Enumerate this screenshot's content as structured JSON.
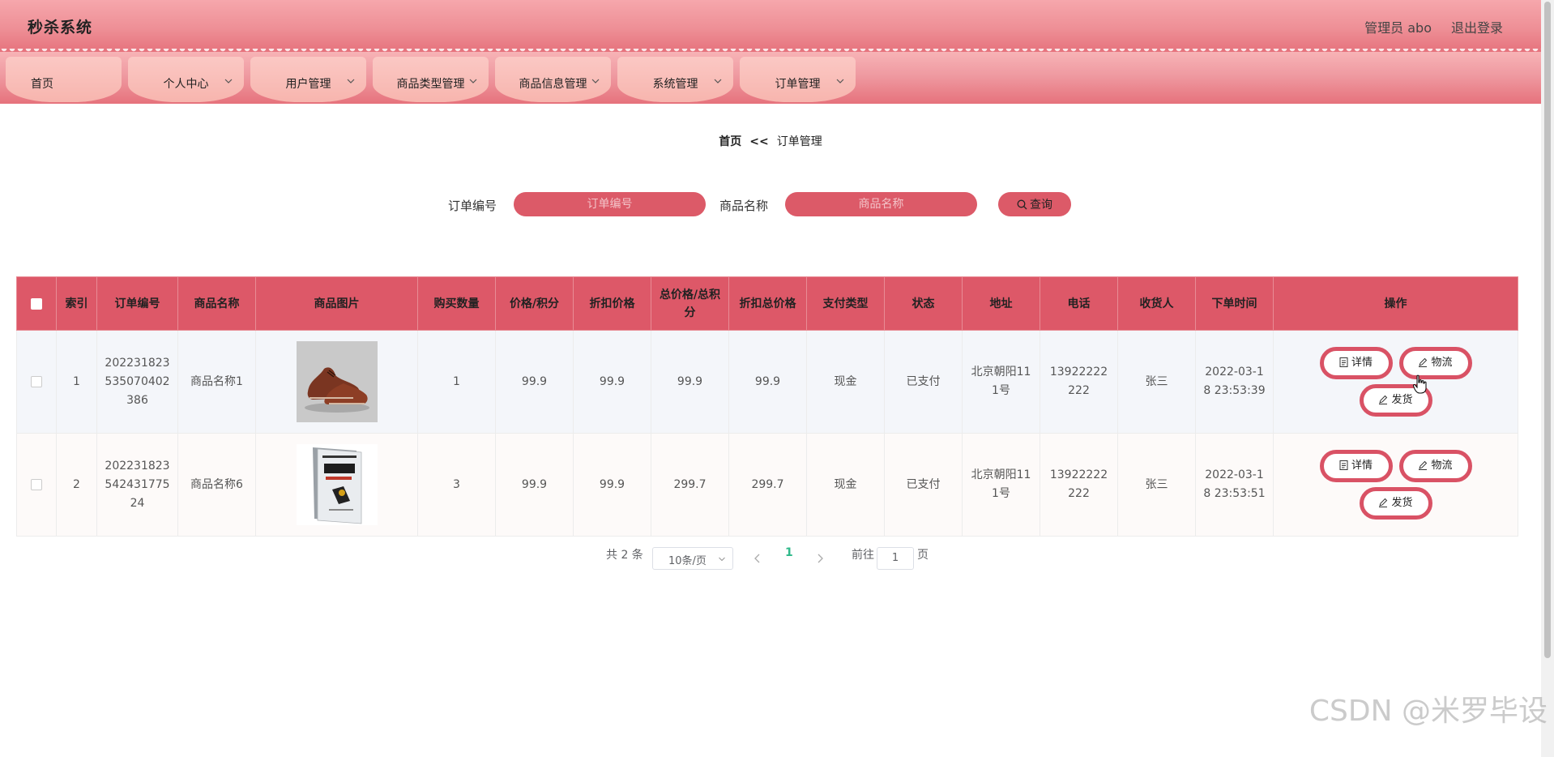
{
  "header": {
    "brand": "秒杀系统",
    "admin_label": "管理员 abo",
    "logout_label": "退出登录"
  },
  "nav": [
    {
      "label": "首页",
      "dropdown": false
    },
    {
      "label": "个人中心",
      "dropdown": true
    },
    {
      "label": "用户管理",
      "dropdown": true
    },
    {
      "label": "商品类型管理",
      "dropdown": true
    },
    {
      "label": "商品信息管理",
      "dropdown": true
    },
    {
      "label": "系统管理",
      "dropdown": true
    },
    {
      "label": "订单管理",
      "dropdown": true
    }
  ],
  "breadcrumb": {
    "home": "首页",
    "separator": "<<",
    "current": "订单管理"
  },
  "search": {
    "order_no_label": "订单编号",
    "order_no_placeholder": "订单编号",
    "product_name_label": "商品名称",
    "product_name_placeholder": "商品名称",
    "query_button": "查询"
  },
  "table": {
    "columns": [
      "索引",
      "订单编号",
      "商品名称",
      "商品图片",
      "购买数量",
      "价格/积分",
      "折扣价格",
      "总价格/总积分",
      "折扣总价格",
      "支付类型",
      "状态",
      "地址",
      "电话",
      "收货人",
      "下单时间",
      "操作"
    ],
    "rows": [
      {
        "index": "1",
        "order_no": "202231823535070402386",
        "product_name": "商品名称1",
        "image": "brown-leather-shoe",
        "quantity": "1",
        "price": "99.9",
        "discount_price": "99.9",
        "total": "99.9",
        "discount_total": "99.9",
        "pay_type": "现金",
        "status": "已支付",
        "address": "北京朝阳111号",
        "phone": "13922222222",
        "receiver": "张三",
        "time": "2022-03-18 23:53:39"
      },
      {
        "index": "2",
        "order_no": "202231823542431775 24",
        "product_name": "商品名称6",
        "image": "book",
        "quantity": "3",
        "price": "99.9",
        "discount_price": "99.9",
        "total": "299.7",
        "discount_total": "299.7",
        "pay_type": "现金",
        "status": "已支付",
        "address": "北京朝阳111号",
        "phone": "13922222222",
        "receiver": "张三",
        "time": "2022-03-18 23:53:51"
      }
    ],
    "actions": {
      "detail": "详情",
      "logistics": "物流",
      "ship": "发货"
    }
  },
  "pager": {
    "total": "共 2 条",
    "page_size": "10条/页",
    "current_page": "1",
    "goto_label": "前往",
    "goto_value": "1",
    "page_suffix": "页"
  },
  "watermark": "CSDN @米罗毕设",
  "colors": {
    "accent": "#dd5868",
    "nav_tab": "#f7b5ae",
    "header": "#ee8f96"
  }
}
